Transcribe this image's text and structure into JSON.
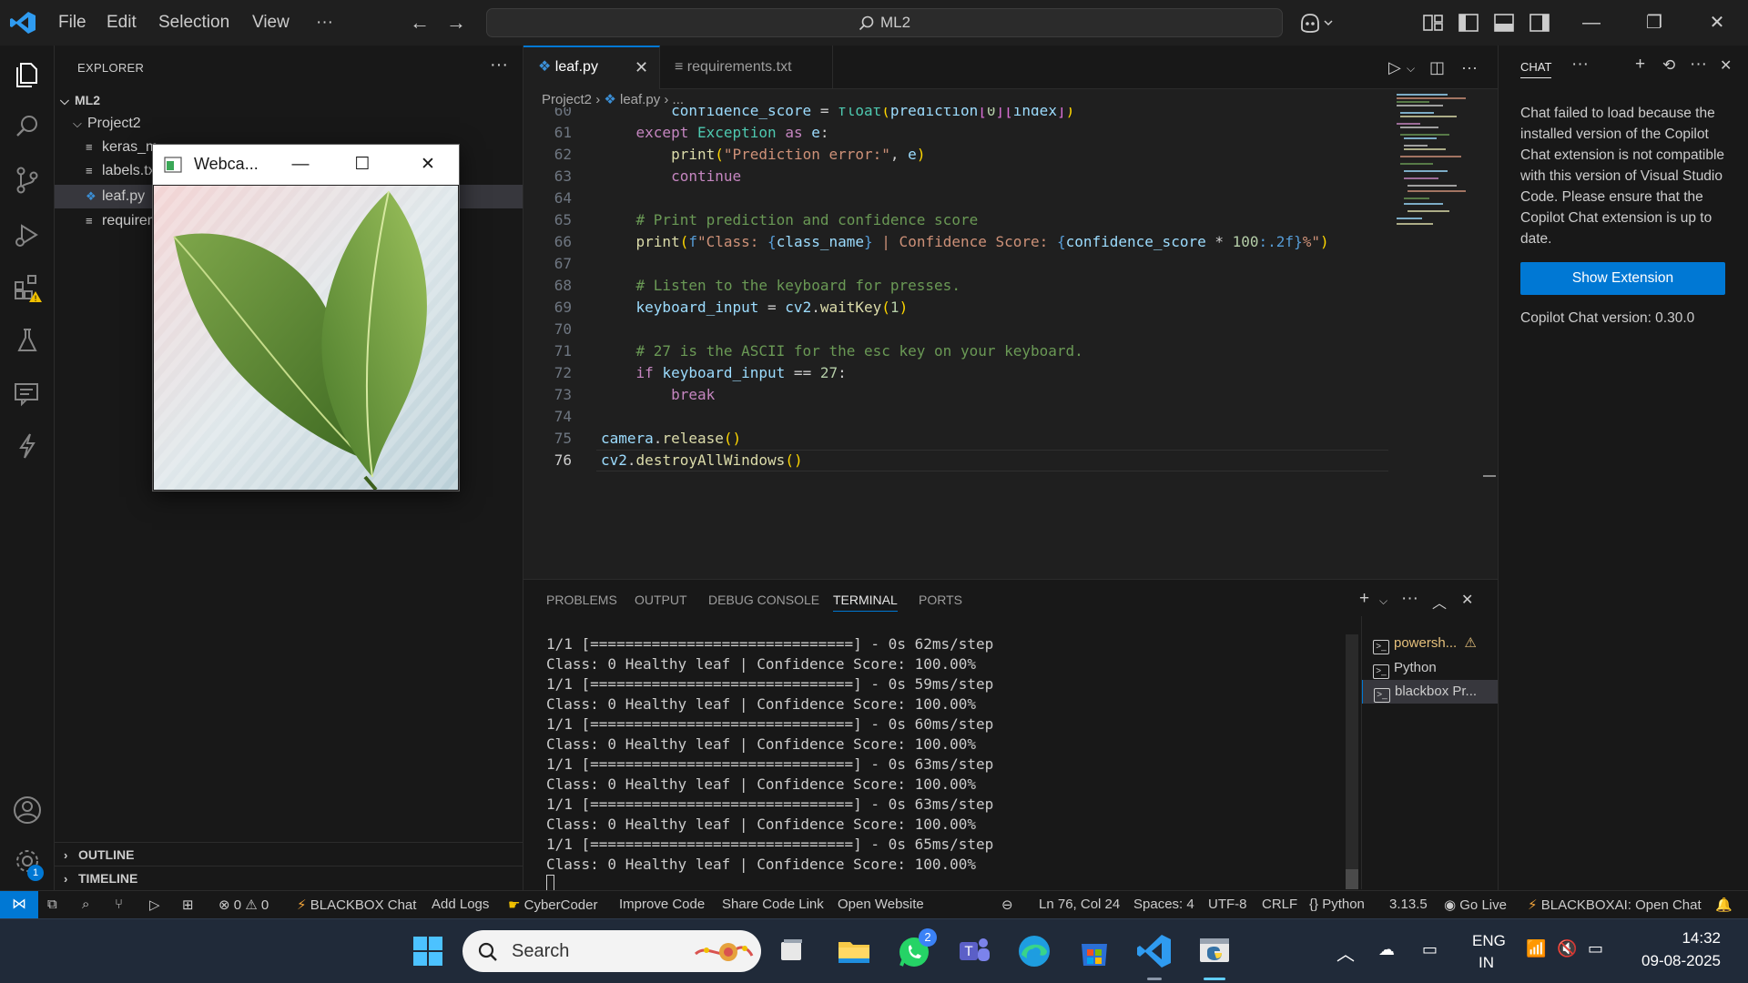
{
  "titlebar": {
    "menu": [
      "File",
      "Edit",
      "Selection",
      "View",
      "···"
    ],
    "search_text": "ML2"
  },
  "sidebar": {
    "title": "EXPLORER",
    "more": "···",
    "root": "ML2",
    "folder": "Project2",
    "files": [
      {
        "name": "keras_m",
        "type": "text"
      },
      {
        "name": "labels.tx",
        "type": "text"
      },
      {
        "name": "leaf.py",
        "type": "python",
        "selected": true
      },
      {
        "name": "requirem",
        "type": "text"
      }
    ],
    "outline": "OUTLINE",
    "timeline": "TIMELINE",
    "settings_badge": "1"
  },
  "editor": {
    "tabs": [
      {
        "label": "leaf.py",
        "active": true
      },
      {
        "label": "requirements.txt",
        "active": false
      }
    ],
    "breadcrumb": [
      "Project2",
      "leaf.py",
      "..."
    ],
    "current_line": 76
  },
  "panel": {
    "tabs": [
      "PROBLEMS",
      "OUTPUT",
      "DEBUG CONSOLE",
      "TERMINAL",
      "PORTS"
    ],
    "active_tab": "TERMINAL",
    "terminal_lines": [
      "1/1 [==============================] - 0s 62ms/step",
      "Class: 0 Healthy leaf | Confidence Score: 100.00%",
      "1/1 [==============================] - 0s 59ms/step",
      "Class: 0 Healthy leaf | Confidence Score: 100.00%",
      "1/1 [==============================] - 0s 60ms/step",
      "Class: 0 Healthy leaf | Confidence Score: 100.00%",
      "1/1 [==============================] - 0s 63ms/step",
      "Class: 0 Healthy leaf | Confidence Score: 100.00%",
      "1/1 [==============================] - 0s 63ms/step",
      "Class: 0 Healthy leaf | Confidence Score: 100.00%",
      "1/1 [==============================] - 0s 65ms/step",
      "Class: 0 Healthy leaf | Confidence Score: 100.00%"
    ],
    "terminals": [
      "powersh...",
      "Python",
      "blackbox Pr..."
    ]
  },
  "chat": {
    "title": "CHAT",
    "message": "Chat failed to load because the installed version of the Copilot Chat extension is not compatible with this version of Visual Studio Code. Please ensure that the Copilot Chat extension is up to date.",
    "button": "Show Extension",
    "version": "Copilot Chat version: 0.30.0"
  },
  "statusbar": {
    "problems": "⊗ 0 ⚠ 0",
    "left_items": [
      "BLACKBOX Chat",
      "Add Logs",
      "CyberCoder",
      "Improve Code",
      "Share Code Link",
      "Open Website"
    ],
    "position": "Ln 76, Col 24",
    "spaces": "Spaces: 4",
    "encoding": "UTF-8",
    "eol": "CRLF",
    "language": "Python",
    "python_version": "3.13.5",
    "go_live": "Go Live",
    "blackbox_open": "BLACKBOXAI: Open Chat"
  },
  "webcam": {
    "title": "Webca..."
  },
  "taskbar": {
    "search": "Search",
    "whatsapp_badge": "2",
    "lang": "ENG",
    "region": "IN",
    "time": "14:32",
    "date": "09-08-2025"
  },
  "colors": {
    "accent": "#0078d4",
    "background": "#1f1f1f",
    "sidebar": "#181818",
    "taskbar": "#202a39"
  }
}
